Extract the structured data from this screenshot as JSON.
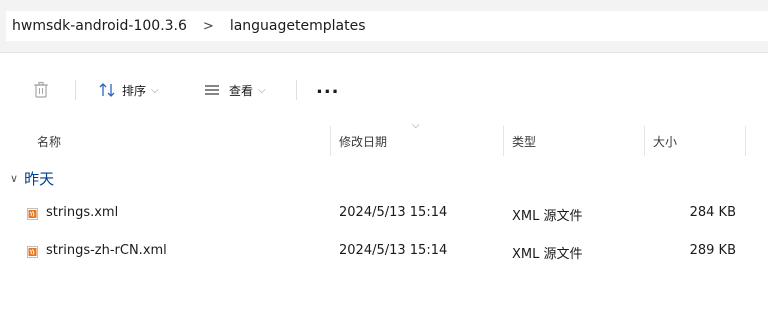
{
  "address": {
    "crumbs": [
      "hwmsdk-android-100.3.6",
      "languagetemplates"
    ],
    "separator": ">"
  },
  "toolbar": {
    "delete_icon": "trash-icon",
    "sort_label": "排序",
    "view_label": "查看",
    "more_label": "..."
  },
  "columns": {
    "name": "名称",
    "modified": "修改日期",
    "type": "类型",
    "size": "大小"
  },
  "group": {
    "label": "昨天"
  },
  "files": [
    {
      "name": "strings.xml",
      "modified": "2024/5/13 15:14",
      "type": "XML 源文件",
      "size": "284 KB"
    },
    {
      "name": "strings-zh-rCN.xml",
      "modified": "2024/5/13 15:14",
      "type": "XML 源文件",
      "size": "289 KB"
    }
  ],
  "colors": {
    "group_header": "#003e92",
    "xml_icon": "#e87722"
  }
}
